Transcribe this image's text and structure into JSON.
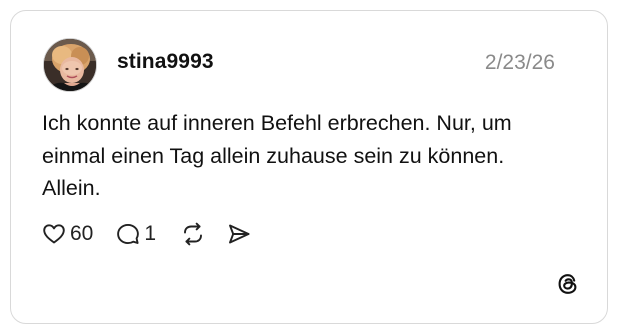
{
  "post": {
    "username": "stina9993",
    "timestamp": "2/23/26",
    "text": "Ich konnte auf inneren Befehl erbrechen. Nur, um einmal einen Tag allein zuhause sein zu können. Allein.",
    "likes": "60",
    "replies": "1"
  },
  "icons": {
    "like": "heart-icon",
    "reply": "speech-bubble-icon",
    "repost": "repost-arrows-icon",
    "share": "send-icon",
    "brand": "threads-logo-icon"
  },
  "colors": {
    "text": "#111111",
    "muted": "#8a8a8a",
    "border": "#d9d9d9"
  }
}
